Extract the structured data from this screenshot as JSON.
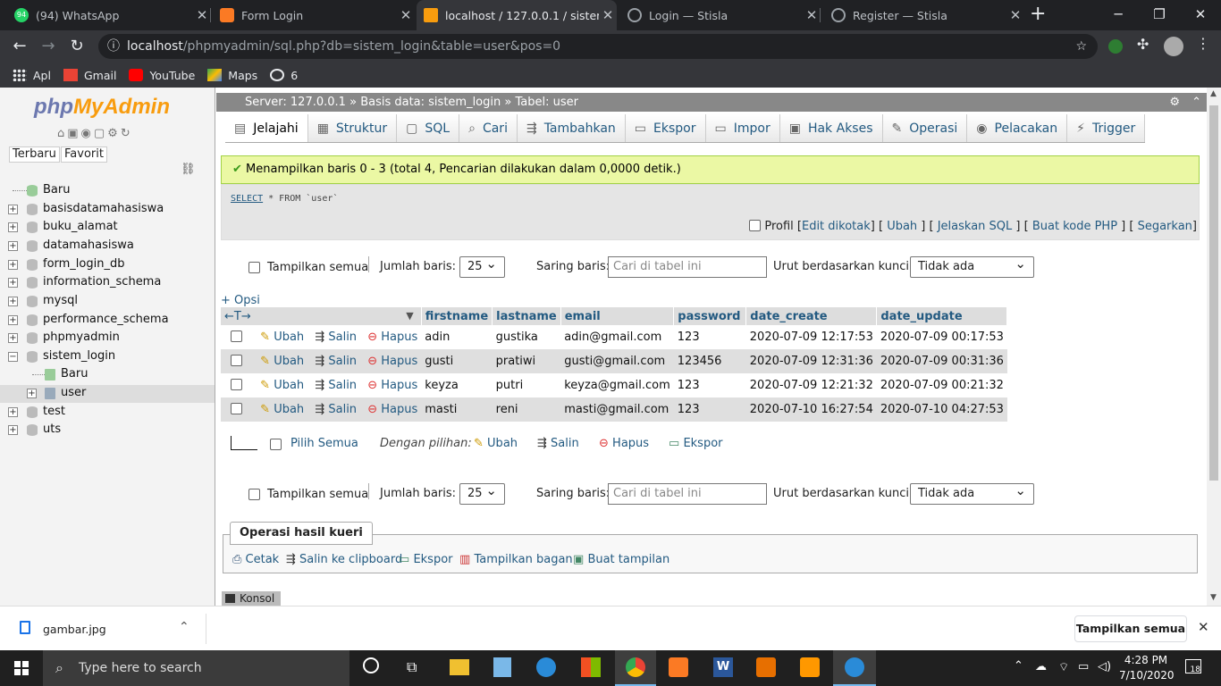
{
  "browser": {
    "tabs": [
      {
        "title": "(94) WhatsApp",
        "badge": "94",
        "color": "#25d366"
      },
      {
        "title": "Form Login",
        "color": "#fb7a24"
      },
      {
        "title": "localhost / 127.0.0.1 / sistem_lo",
        "color": "#f89c0e",
        "active": true
      },
      {
        "title": "Login — Stisla",
        "color": "#9aa0a6"
      },
      {
        "title": "Register — Stisla",
        "color": "#9aa0a6"
      }
    ],
    "url_host": "localhost",
    "url_path": "/phpmyadmin/sql.php?db=sistem_login&table=user&pos=0",
    "bookmarks": [
      "Apl",
      "Gmail",
      "YouTube",
      "Maps",
      "6"
    ]
  },
  "sidebar": {
    "logo_php": "php",
    "logo_ma": "MyAdmin",
    "tab_recent": "Terbaru",
    "tab_fav": "Favorit",
    "items": [
      "Baru",
      "basisdatamahasiswa",
      "buku_alamat",
      "datamahasiswa",
      "form_login_db",
      "information_schema",
      "mysql",
      "performance_schema",
      "phpmyadmin",
      "sistem_login",
      "Baru",
      "user",
      "test",
      "uts"
    ]
  },
  "breadcrumb": {
    "server": "Server: 127.0.0.1",
    "db": "Basis data: sistem_login",
    "table": "Tabel: user",
    "sep": "»"
  },
  "menu": [
    "Jelajahi",
    "Struktur",
    "SQL",
    "Cari",
    "Tambahkan",
    "Ekspor",
    "Impor",
    "Hak Akses",
    "Operasi",
    "Pelacakan",
    "Trigger"
  ],
  "result": {
    "message": "Menampilkan baris 0 - 3 (total 4, Pencarian dilakukan dalam 0,0000 detik.)",
    "query_kw1": "SELECT",
    "query_rest": " * FROM `user`",
    "profile": "Profil",
    "edit_inline": "Edit dikotak",
    "edit": "Ubah",
    "explain": "Jelaskan SQL",
    "php": "Buat kode PHP",
    "refresh": "Segarkan"
  },
  "controls": {
    "show_all": "Tampilkan semua",
    "rows_label": "Jumlah baris:",
    "rows_value": "25",
    "filter_label": "Saring baris:",
    "filter_placeholder": "Cari di tabel ini",
    "sort_label": "Urut berdasarkan kunci:",
    "sort_value": "Tidak ada",
    "options": "+ Opsi"
  },
  "table": {
    "columns": [
      "firstname",
      "lastname",
      "email",
      "password",
      "date_create",
      "date_update"
    ],
    "actions": {
      "edit": "Ubah",
      "copy": "Salin",
      "delete": "Hapus"
    },
    "rows": [
      [
        "adin",
        "gustika",
        "adin@gmail.com",
        "123",
        "2020-07-09 12:17:53",
        "2020-07-09 00:17:53"
      ],
      [
        "gusti",
        "pratiwi",
        "gusti@gmail.com",
        "123456",
        "2020-07-09 12:31:36",
        "2020-07-09 00:31:36"
      ],
      [
        "keyza",
        "putri",
        "keyza@gmail.com",
        "123",
        "2020-07-09 12:21:32",
        "2020-07-09 00:21:32"
      ],
      [
        "masti",
        "reni",
        "masti@gmail.com",
        "123",
        "2020-07-10 16:27:54",
        "2020-07-10 04:27:53"
      ]
    ]
  },
  "bulk": {
    "select_all": "Pilih Semua",
    "with_selected": "Dengan pilihan:",
    "edit": "Ubah",
    "copy": "Salin",
    "delete": "Hapus",
    "export": "Ekspor"
  },
  "ops": {
    "legend": "Operasi hasil kueri",
    "print": "Cetak",
    "clipboard": "Salin ke clipboard",
    "export": "Ekspor",
    "chart": "Tampilkan bagan",
    "view": "Buat tampilan"
  },
  "console": "Konsol",
  "download": {
    "file": "gambar.jpg",
    "show_all": "Tampilkan semua"
  },
  "taskbar": {
    "search": "Type here to search",
    "time": "4:28 PM",
    "date": "7/10/2020",
    "notif": "18"
  }
}
